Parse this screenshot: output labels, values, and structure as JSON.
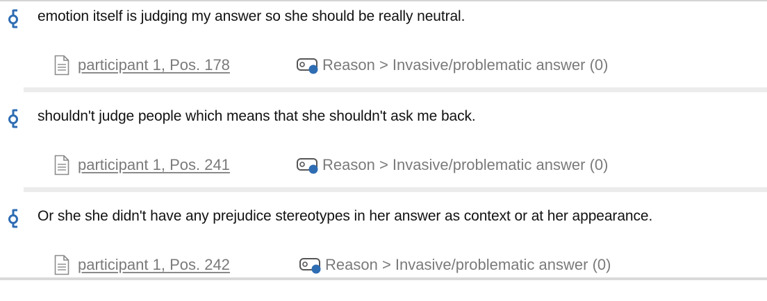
{
  "colors": {
    "coding_stripe": "#2f6db3",
    "code_dot": "#2f6db3",
    "link_text": "#7a7a7a",
    "separator": "#ececec"
  },
  "segments": [
    {
      "text": "emotion itself is judging my answer so she should be really neutral.",
      "document_label": "participant 1, Pos. 178",
      "code_label": "Reason > Invasive/problematic answer  (0)",
      "icons": {
        "stripe": "coding-stripe-icon",
        "document": "document-icon",
        "code": "code-tag-icon"
      }
    },
    {
      "text": "shouldn't judge people which means that she shouldn't ask me back.",
      "document_label": "participant 1, Pos. 241",
      "code_label": "Reason > Invasive/problematic answer  (0)",
      "icons": {
        "stripe": "coding-stripe-icon",
        "document": "document-icon",
        "code": "code-tag-icon"
      }
    },
    {
      "text": "Or she she didn't have any prejudice stereotypes in her answer as context or at her appearance.",
      "document_label": "participant 1, Pos. 242",
      "code_label": "Reason > Invasive/problematic answer  (0)",
      "icons": {
        "stripe": "coding-stripe-icon",
        "document": "document-icon",
        "code": "code-tag-icon"
      }
    }
  ]
}
